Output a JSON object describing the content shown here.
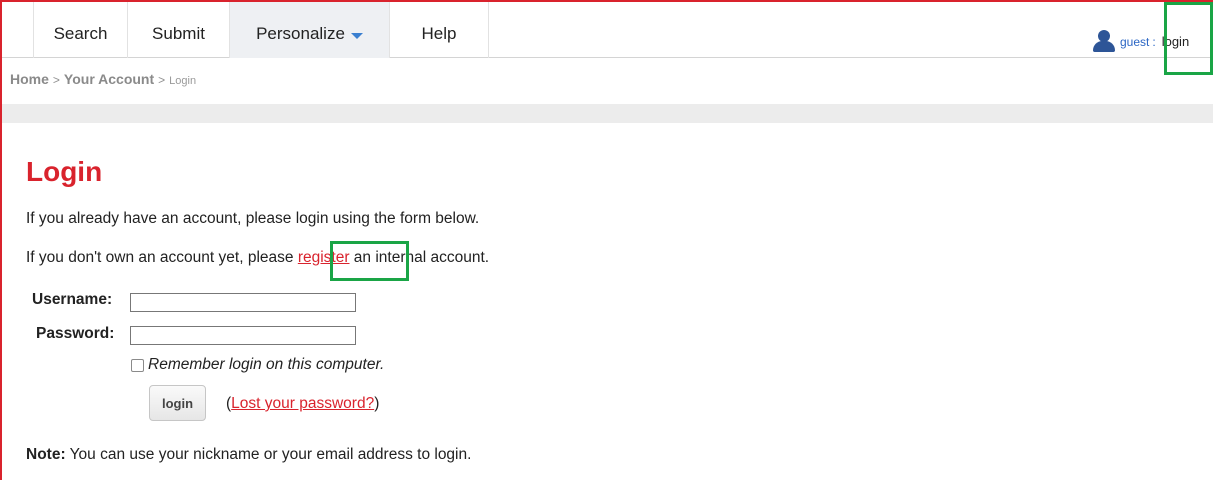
{
  "nav": {
    "tabs": [
      {
        "label": "Search"
      },
      {
        "label": "Submit"
      },
      {
        "label": "Personalize"
      },
      {
        "label": "Help"
      }
    ],
    "user": "guest",
    "separator": ":",
    "login_label": "login"
  },
  "breadcrumb": {
    "home": "Home",
    "sep": ">",
    "account": "Your Account",
    "current": "Login"
  },
  "page": {
    "title": "Login",
    "intro": "If you already have an account, please login using the form below.",
    "register_pre": "If you don't own an account yet, please ",
    "register_link": "register",
    "register_post": " an internal account."
  },
  "form": {
    "username_label": "Username:",
    "username_value": "",
    "password_label": "Password:",
    "password_value": "",
    "remember_label": "Remember login on this computer.",
    "login_button": "login",
    "lost_open": "(",
    "lost_link": "Lost your password?",
    "lost_close": ")"
  },
  "note": {
    "label": "Note:",
    "text": " You can use your nickname or your email address to login."
  },
  "colors": {
    "accent_red": "#d9232d",
    "highlight_green": "#1aa546",
    "user_blue": "#2b66c4"
  }
}
